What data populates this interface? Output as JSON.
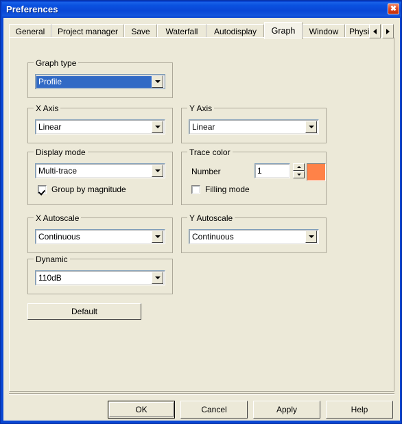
{
  "window": {
    "title": "Preferences",
    "close_label": "✖",
    "accent_titlebar": "#0a52e0",
    "face_color": "#ece9d8"
  },
  "tabs": {
    "items": [
      {
        "label": "General",
        "selected": false
      },
      {
        "label": "Project manager",
        "selected": false
      },
      {
        "label": "Save",
        "selected": false
      },
      {
        "label": "Waterfall",
        "selected": false
      },
      {
        "label": "Autodisplay",
        "selected": false
      },
      {
        "label": "Graph",
        "selected": true
      },
      {
        "label": "Window",
        "selected": false
      },
      {
        "label": "Physic",
        "selected": false
      }
    ],
    "scroll_left_icon": "left-arrow-icon",
    "scroll_right_icon": "right-arrow-icon"
  },
  "graph_type": {
    "group_label": "Graph type",
    "value": "Profile",
    "dropdown_icon": "chevron-down-icon"
  },
  "x_axis": {
    "group_label": "X Axis",
    "value": "Linear",
    "dropdown_icon": "chevron-down-icon"
  },
  "y_axis": {
    "group_label": "Y Axis",
    "value": "Linear",
    "dropdown_icon": "chevron-down-icon"
  },
  "display_mode": {
    "group_label": "Display mode",
    "value": "Multi-trace",
    "dropdown_icon": "chevron-down-icon",
    "checkbox_label": "Group by magnitude",
    "checkbox_checked": true
  },
  "trace_color": {
    "group_label": "Trace color",
    "number_label": "Number",
    "number_value": "1",
    "spin_up_icon": "up-arrow-icon",
    "spin_down_icon": "down-arrow-icon",
    "swatch_color": "#ff8248",
    "checkbox_label": "Filling mode",
    "checkbox_checked": false
  },
  "x_autoscale": {
    "group_label": "X Autoscale",
    "value": "Continuous",
    "dropdown_icon": "chevron-down-icon"
  },
  "y_autoscale": {
    "group_label": "Y Autoscale",
    "value": "Continuous",
    "dropdown_icon": "chevron-down-icon"
  },
  "dynamic": {
    "group_label": "Dynamic",
    "value": "110dB",
    "dropdown_icon": "chevron-down-icon"
  },
  "default_button": {
    "label": "Default"
  },
  "footer": {
    "ok": "OK",
    "cancel": "Cancel",
    "apply": "Apply",
    "help": "Help"
  }
}
